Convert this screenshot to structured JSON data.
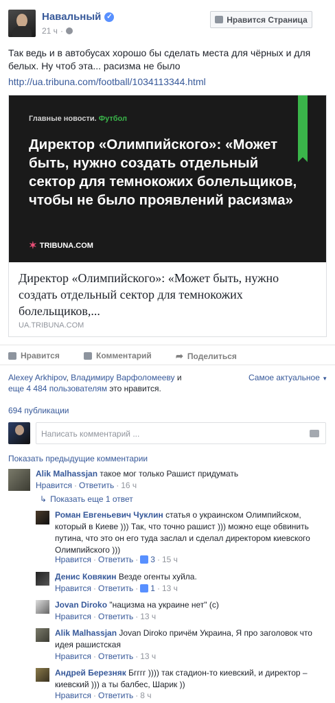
{
  "header": {
    "page_name": "Навальный",
    "verified_icon": "verified-badge-icon",
    "time": "21 ч",
    "privacy_icon": "globe-icon",
    "like_page_button": "Нравится Страница"
  },
  "post": {
    "text": "Так ведь и в автобусах хорошо бы сделать места для чёрных и для белых. Ну чтоб эта... расизма не было",
    "link": "http://ua.tribuna.com/football/1034113344.html"
  },
  "attachment": {
    "image_label_prefix": "Главные новости.",
    "image_label_section": "Футбол",
    "image_headline": "Директор «Олимпийского»: «Может быть, нужно создать отдельный сектор для темнокожих болельщиков, чтобы не было проявлений расизма»",
    "image_logo": "TRIBUNA.COM",
    "title": "Директор «Олимпийского»: «Может быть, нужно создать отдельный сектор для темнокожих болельщиков,...",
    "domain": "UA.TRIBUNA.COM",
    "accent_color": "#3ab54a"
  },
  "actions": {
    "like": "Нравится",
    "comment": "Комментарий",
    "share": "Поделиться"
  },
  "likes": {
    "name1": "Alexey Arkhipov",
    "sep": ", ",
    "name2": "Владимиру Варфоломееву",
    "and": " и",
    "others": "еще 4 484 пользователям",
    "suffix": " это нравится.",
    "sort": "Самое актуальное"
  },
  "shares": "694 публикации",
  "composer": {
    "placeholder": "Написать комментарий ...",
    "camera_icon": "camera-icon"
  },
  "show_previous": "Показать предыдущие комментарии",
  "comments": [
    {
      "author": "Alik Malhassjan",
      "text": "такое мог только Рашист придумать",
      "like": "Нравится",
      "reply": "Ответить",
      "time": "16 ч"
    }
  ],
  "show_reply": "Показать еще 1 ответ",
  "replies": [
    {
      "author": "Роман Евгеньевич Чуклин",
      "text": "статья о украинском Олимпийском, который в Киеве ))) Так, что точно рашист ))) можно еще обвинить путина, что это он его туда заслал и сделал директором киевского Олимпийского )))",
      "like": "Нравится",
      "reply": "Ответить",
      "likes": "3",
      "time": "15 ч"
    },
    {
      "author": "Денис Ковякин",
      "text": "Везде огенты хуйла.",
      "like": "Нравится",
      "reply": "Ответить",
      "likes": "1",
      "time": "13 ч"
    },
    {
      "author": "Jovan Diroko",
      "text": "\"нацизма на украине нет\" (с)",
      "like": "Нравится",
      "reply": "Ответить",
      "time": "13 ч"
    },
    {
      "author": "Alik Malhassjan",
      "text": "Jovan Diroko причём Украина, Я про заголовок что идея рашистская",
      "like": "Нравится",
      "reply": "Ответить",
      "time": "13 ч"
    },
    {
      "author": "Андрей Березняк",
      "text": "Бгггг )))) так стадион-то киевский, и директор – киевский ))) а ты балбес, Шарик ))",
      "like": "Нравится",
      "reply": "Ответить",
      "time": "8 ч"
    }
  ],
  "separator": "·"
}
